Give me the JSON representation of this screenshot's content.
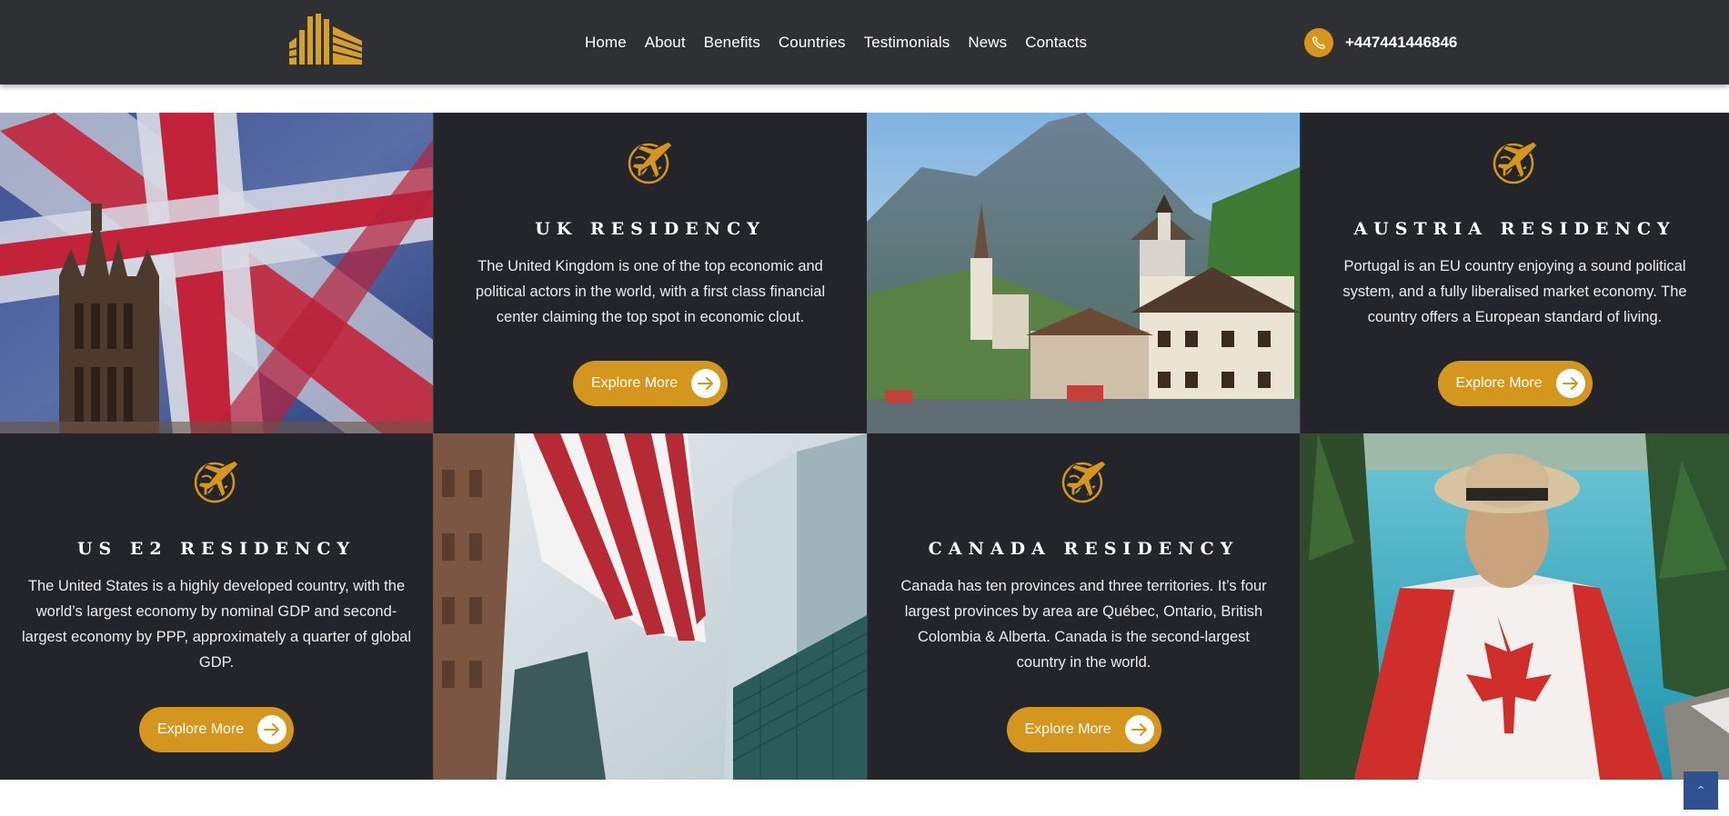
{
  "header": {
    "logo_name": "building-logo",
    "nav": [
      "Home",
      "About",
      "Benefits",
      "Countries",
      "Testimonials",
      "News",
      "Contacts"
    ],
    "phone": "+447441446846",
    "accent": "#d4961c",
    "background": "#2e3033"
  },
  "cards": {
    "uk": {
      "title": "UK RESIDENCY",
      "text": "The United Kingdom is one of the top economic and political actors in the world, with a first class financial center claiming the top spot in economic clout.",
      "button": "Explore More"
    },
    "austria": {
      "title": "AUSTRIA RESIDENCY",
      "text": "Portugal is an EU country enjoying a sound political system, and a fully liberalised market economy. The country offers a European standard of living.",
      "button": "Explore More"
    },
    "us": {
      "title": "US E2 RESIDENCY",
      "text": "The United States is a highly developed country, with the world’s largest economy by nominal GDP and second-largest economy by PPP, approximately a quarter of global GDP.",
      "button": "Explore More"
    },
    "canada": {
      "title": "CANADA RESIDENCY",
      "text": "Canada has ten provinces and three territories. It’s four largest provinces by area are Québec, Ontario, British Colombia & Alberta. Canada is the second-largest country in the world.",
      "button": "Explore More"
    }
  },
  "icons": {
    "card_emblem": "plane-globe-icon",
    "button_arrow": "arrow-right-icon",
    "phone": "phone-icon",
    "scroll_top": "chevron-up-icon"
  },
  "scroll_top_glyph": "⌃"
}
